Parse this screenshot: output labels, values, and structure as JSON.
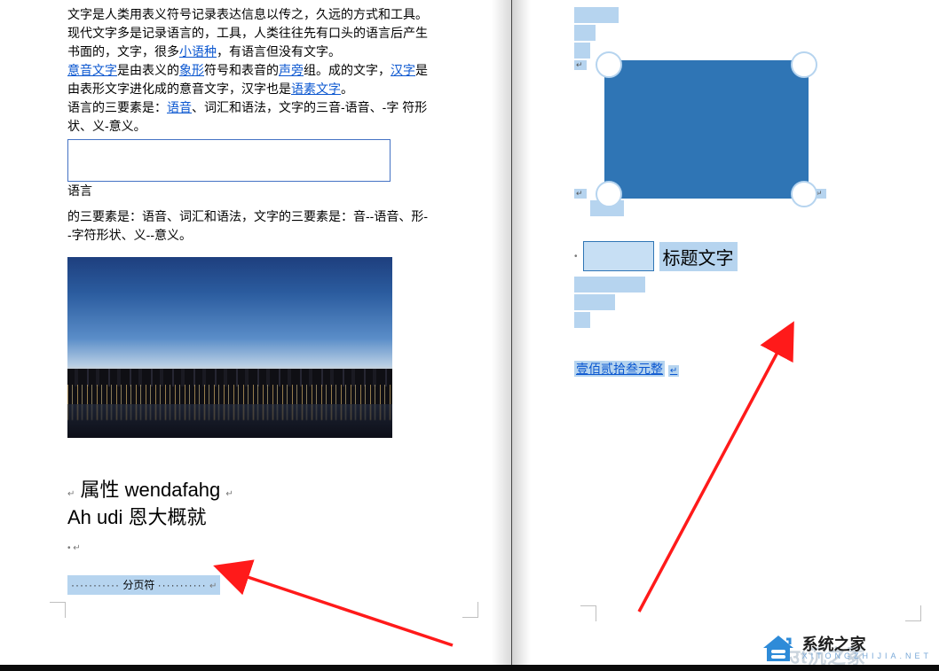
{
  "leftPage": {
    "para1_a": "文字是人类用表义符号记录表达信息以传之，久远的方式和工具。现代文字多是记录语言的，工具，人类往往先有口头的语言后产生书面的，文字，很多",
    "link1": "小语种",
    "para1_b": "，有语言但没有文字。",
    "link2": "意音文字",
    "mid1": "是由表义的",
    "link3": "象形",
    "mid2": "符号和表音的",
    "link4": "声旁",
    "mid3": "组。成的文字，",
    "link5": "汉字",
    "mid4": "是由表形文字进化成的意音文字，汉字也是",
    "link6": "语素文字",
    "mid5": "。",
    "para3a": "语言的三要素是：",
    "link7": "语音",
    "para3b": "、词汇和语法，文字的三音-语音、-字 符形状、义-意义。",
    "after_box": "语言",
    "para4": "的三要素是：语音、词汇和语法，文字的三要素是：音--语音、形--字符形状、义--意义。",
    "heading_line1_a": "属性 wendafahg",
    "heading_line2": "Ah  udi 恩大概就",
    "page_break_label": "分页符"
  },
  "rightPage": {
    "caption": "标题文字",
    "amount": "壹佰贰拾叁元整"
  },
  "watermark": {
    "cn": "系统之家",
    "en": "XITONGZHIJIA.NET",
    "faded": "उ⁠t沉之冢"
  }
}
